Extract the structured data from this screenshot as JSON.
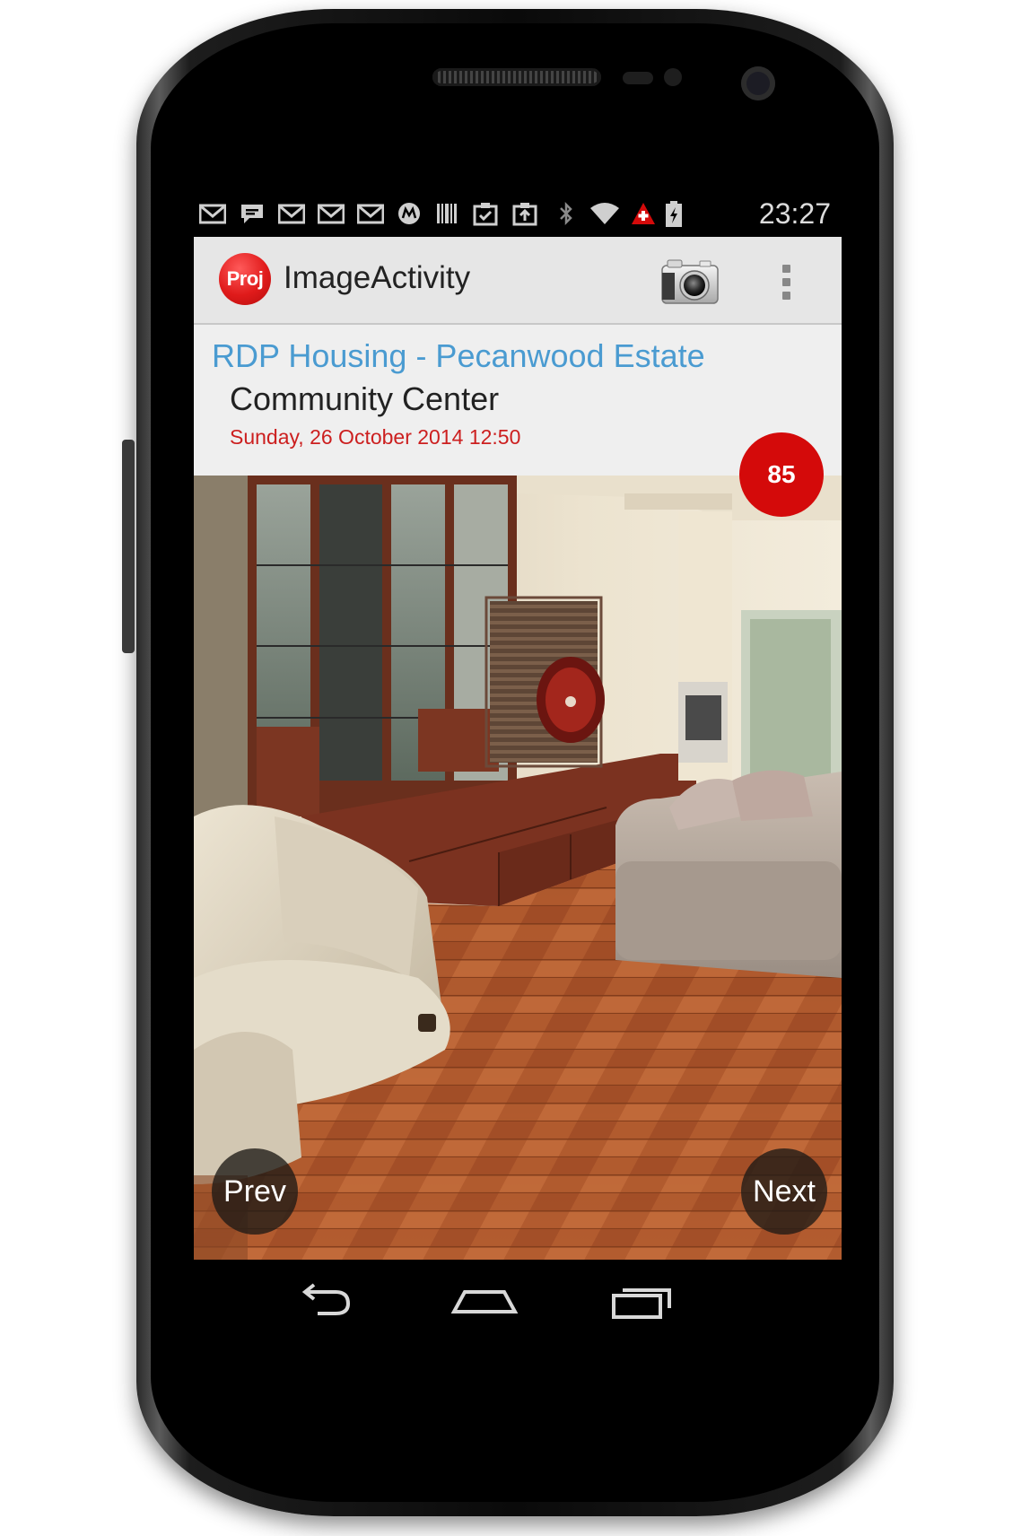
{
  "statusbar": {
    "time": "23:27",
    "icons": [
      "gmail-icon",
      "chat-icon",
      "gmail-icon",
      "gmail-icon",
      "gmail-icon",
      "motorola-icon",
      "barcode-icon",
      "clipboard-check-icon",
      "clipboard-upload-icon",
      "bluetooth-icon",
      "wifi-icon",
      "alert-icon",
      "battery-charging-icon"
    ]
  },
  "actionbar": {
    "logo_text": "Proj",
    "title": "ImageActivity",
    "camera_icon": "camera-icon",
    "overflow_icon": "overflow-menu-icon"
  },
  "header": {
    "project_name": "RDP Housing - Pecanwood Estate",
    "site_name": "Community Center",
    "date": "Sunday, 26 October 2014 12:50"
  },
  "badge": {
    "count": "85",
    "color": "#d40a0a"
  },
  "photo": {
    "description_icon": "living-room-photo"
  },
  "navigation": {
    "prev_label": "Prev",
    "next_label": "Next"
  },
  "system_nav": [
    "back-icon",
    "home-icon",
    "recents-icon"
  ],
  "colors": {
    "accent_blue": "#4a9bd1",
    "date_red": "#cc1f1f",
    "badge_red": "#d40a0a",
    "actionbar_bg": "#e6e6e6"
  }
}
